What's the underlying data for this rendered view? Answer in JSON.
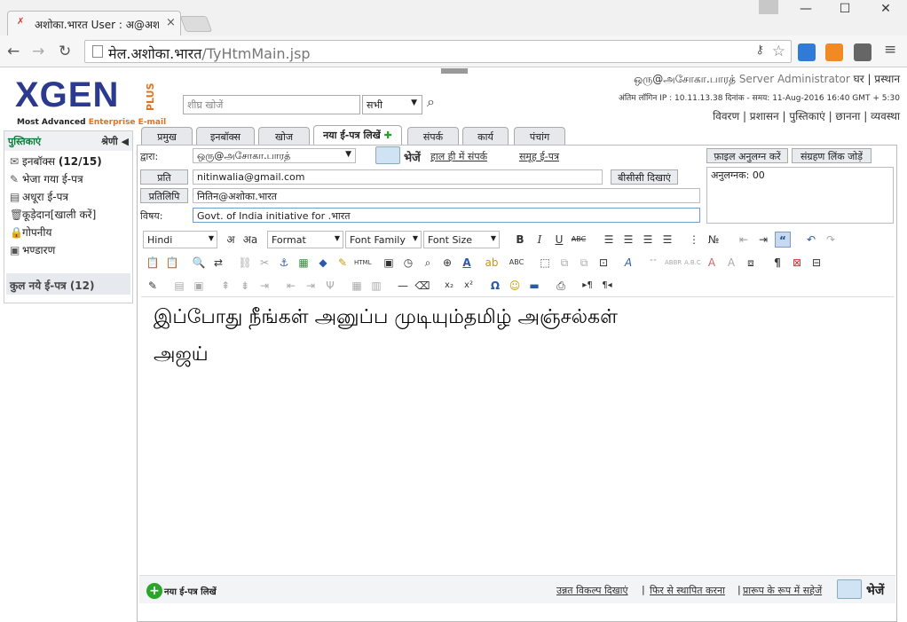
{
  "browser": {
    "tab_title": "अशोका.भारत User : अ@अश",
    "url_host": "मेल.अशोका.भारत",
    "url_path": "/TyHtmMain.jsp"
  },
  "header": {
    "logo_text": "XGEN",
    "logo_plus": "PLUS",
    "logo_tagline_a": "Most Advanced ",
    "logo_tagline_b": "Enterprise E-mail",
    "search_placeholder": "शीघ्र खोजें",
    "search_scope": "सभी",
    "user_email": "ஒரு@அசோகா.பாரத்",
    "user_role": "Server Administrator",
    "home_link": "घर",
    "logout_link": "प्रस्थान",
    "last_login": "अंतिम लॉगिन IP : 10.11.13.38 दिनांक - समय: 11-Aug-2016 16:40 GMT + 5:30",
    "nav": [
      "विवरण",
      "प्रशासन",
      "पुस्तिकाएं",
      "छानना",
      "व्यवस्था"
    ]
  },
  "sidebar": {
    "title": "पुस्तिकाएं",
    "sort": "श्रेणी",
    "folders": [
      {
        "label": "इनबॉक्स",
        "count": "(12/15)",
        "icon": "inbox-icon"
      },
      {
        "label": "भेजा गया ई-पत्र",
        "count": "",
        "icon": "sent-icon"
      },
      {
        "label": "अधूरा ई-पत्र",
        "count": "",
        "icon": "draft-icon"
      },
      {
        "label": "कूड़ेदान",
        "count": "[खाली करें]",
        "icon": "trash-icon"
      },
      {
        "label": "गोपनीय",
        "count": "",
        "icon": "lock-icon"
      },
      {
        "label": "भण्डारण",
        "count": "",
        "icon": "storage-icon"
      }
    ],
    "total_label": "कुल नये ई-पत्र (12)"
  },
  "tabs": [
    "प्रमुख",
    "इनबॉक्स",
    "खोज",
    "नया ई-पत्र लिखें",
    "संपर्क",
    "कार्य",
    "पंचांग"
  ],
  "compose": {
    "from_label": "द्वारा:",
    "from_value": "ஒரு@அசோகா.பாரத்",
    "send_label": "भेजें",
    "recent_contacts": "हाल ही में संपर्क",
    "group_email": "समूह ई-पत्र",
    "to_button": "प्रति",
    "to_value": "nitinwalia@gmail.com",
    "bcc_button": "बीसीसी  दिखाएं",
    "cc_button": "प्रतिलिपि",
    "cc_value": "नितिन@अशोका.भारत",
    "subject_label": "विषय:",
    "subject_value": "Govt. of India initiative for .भारत",
    "attach_button": "फ़ाइल अनुलग्न करें",
    "storage_link_button": "संग्रहण लिंक जोड़ें",
    "attachments_text": "अनुलग्नक: 00",
    "body_line1": "இப்போது நீங்கள் அனுப்ப முடியும்தமிழ் அஞ்சல்கள்",
    "body_line2": "அஜய்"
  },
  "toolbar": {
    "language": "Hindi",
    "format": "Format",
    "font_family": "Font Family",
    "font_size": "Font Size"
  },
  "footer": {
    "new_mail": "नया ई-पत्र लिखें",
    "advanced": "उन्नत विकल्प दिखाएं",
    "restore": "फिर से स्थापित करना",
    "save_draft": "प्रारूप के रूप में सहेजें",
    "send": "भेजें"
  },
  "colors": {
    "brand_blue": "#2b3a8f",
    "brand_orange": "#e8701a",
    "green": "#0a7a3a"
  }
}
